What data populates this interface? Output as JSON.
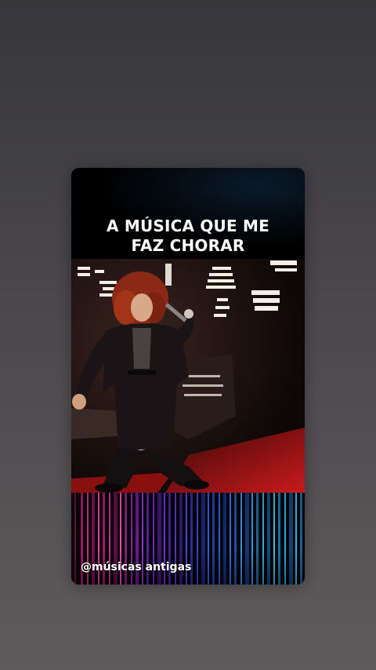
{
  "story": {
    "title_line1": "A MÚSICA QUE ME",
    "title_line2": "FAZ CHORAR",
    "handle": "@músicas antigas"
  },
  "colors": {
    "background_top": "#37363b",
    "background_bottom": "#5f5b5c",
    "title_text": "#ffffff",
    "stage_red": "#b81418",
    "light_pink": "#e0228a",
    "light_purple": "#7a2ae0",
    "light_blue": "#2a6af0",
    "light_cyan": "#30c8f0"
  }
}
